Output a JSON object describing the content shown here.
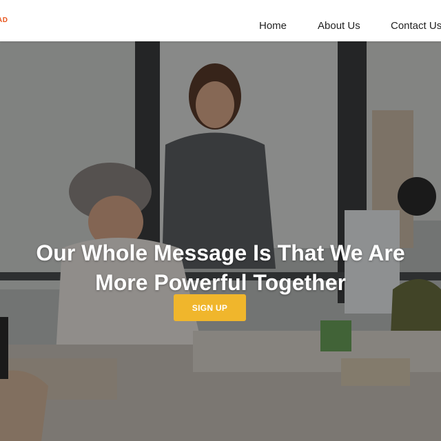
{
  "header": {
    "brand": "AD",
    "nav": {
      "home": "Home",
      "about": "About Us",
      "contact": "Contact Us"
    }
  },
  "hero": {
    "title_line1": "Our Whole Message Is That We Are",
    "title_line2": "More Powerful Together",
    "signup_label": "SIGN UP"
  },
  "colors": {
    "brand": "#e8541c",
    "accent": "#f0b62c",
    "nav_text": "#222222"
  }
}
